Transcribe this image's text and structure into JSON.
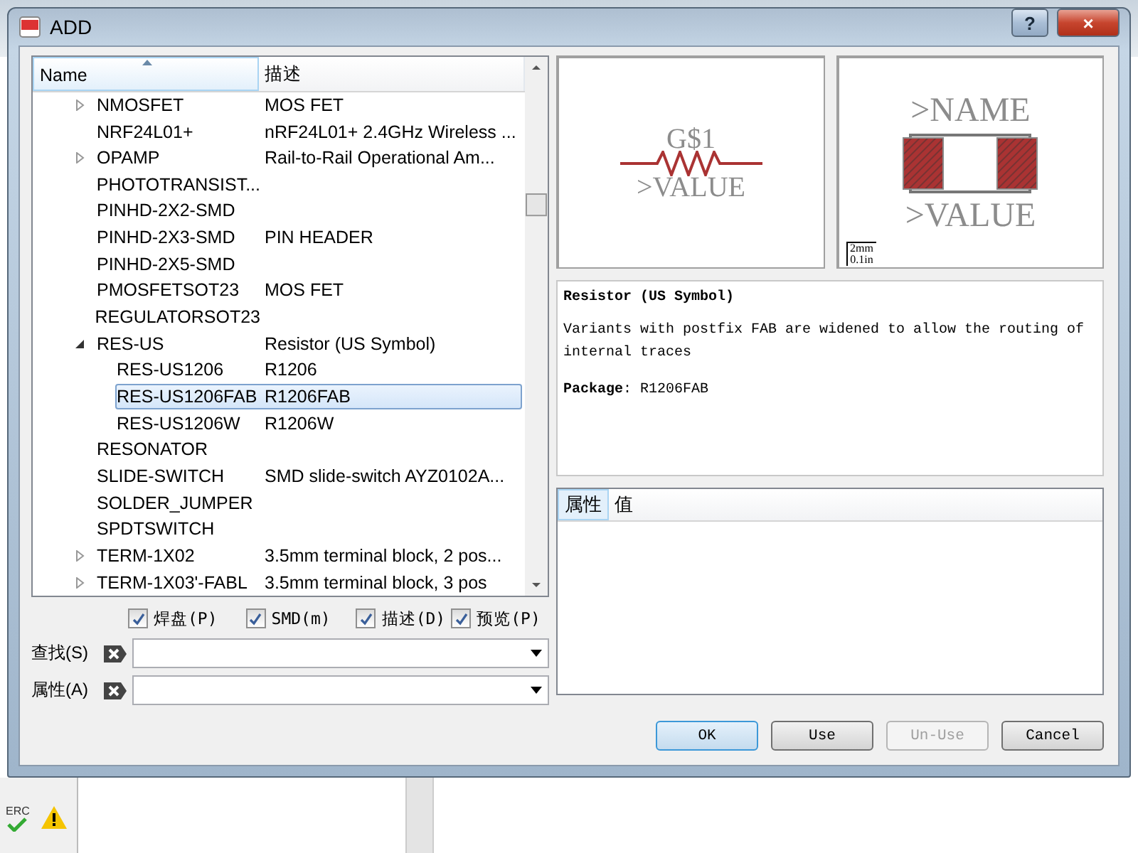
{
  "window": {
    "title": "ADD",
    "help": "?",
    "close": "×"
  },
  "tree": {
    "columns": [
      "Name",
      "描述"
    ],
    "items": [
      {
        "name": "NMOSFET",
        "description": "MOS FET",
        "expanded": false,
        "selected": false
      },
      {
        "name": "NRF24L01+",
        "description": "nRF24L01+ 2.4GHz Wireless ...",
        "selected": false
      },
      {
        "name": "OPAMP",
        "description": "Rail-to-Rail Operational Am...",
        "expanded": false,
        "selected": false
      },
      {
        "name": "PHOTOTRANSIST...",
        "selected": false
      },
      {
        "name": "PINHD-2X2-SMD",
        "selected": false
      },
      {
        "name": "PINHD-2X3-SMD",
        "description": "PIN HEADER",
        "selected": false
      },
      {
        "name": "PINHD-2X5-SMD",
        "selected": false
      },
      {
        "name": "PMOSFETSOT23",
        "description": "MOS FET",
        "selected": false
      },
      {
        "name": "REGULATORSOT23",
        "selected": false
      },
      {
        "name": "RES-US",
        "description": "Resistor (US Symbol)",
        "expanded": true,
        "selected": false,
        "children": [
          {
            "name": "RES-US1206",
            "description": "R1206",
            "selected": false
          },
          {
            "name": "RES-US1206FAB",
            "description": "R1206FAB",
            "selected": true
          },
          {
            "name": "RES-US1206W",
            "description": "R1206W",
            "selected": false
          }
        ]
      },
      {
        "name": "RESONATOR",
        "selected": false
      },
      {
        "name": "SLIDE-SWITCH",
        "description": "SMD slide-switch AYZ0102A...",
        "selected": false
      },
      {
        "name": "SOLDER_JUMPER",
        "selected": false
      },
      {
        "name": "SPDTSWITCH",
        "selected": false
      },
      {
        "name": "TERM-1X02",
        "description": "3.5mm terminal block, 2 pos...",
        "expanded": false,
        "selected": false
      },
      {
        "name": "TERM-1X03'-FABL",
        "description": "3.5mm terminal block, 3 pos",
        "expanded": false,
        "selected": false
      }
    ]
  },
  "filters": [
    {
      "label": "焊盘(P)",
      "checked": true
    },
    {
      "label": "SMD(m)",
      "checked": true
    },
    {
      "label": "描述(D)",
      "checked": true
    },
    {
      "label": "预览(P)",
      "checked": true
    }
  ],
  "fields": [
    {
      "label": "查找(S)"
    },
    {
      "label": "属性(A)"
    }
  ],
  "symbol_preview": {
    "name": "G$1",
    "value": ">VALUE"
  },
  "package_preview": {
    "name": ">NAME",
    "value": ">VALUE",
    "scale_metric": "2mm",
    "scale_imperial": "0.1in"
  },
  "description": {
    "title": "Resistor (US Symbol)",
    "body": "Variants with postfix FAB are widened to allow the routing of internal traces",
    "package": "**Package**: R1206FAB"
  },
  "attributes": {
    "columns": [
      "属性",
      "值"
    ]
  },
  "buttons": [
    {
      "label": "OK",
      "disabled": false,
      "default": true
    },
    {
      "label": "Use",
      "disabled": false,
      "default": false
    },
    {
      "label": "Un-Use",
      "disabled": true,
      "default": false
    },
    {
      "label": "Cancel",
      "disabled": false,
      "default": false
    }
  ],
  "background": {
    "erc_label": "ERC"
  }
}
